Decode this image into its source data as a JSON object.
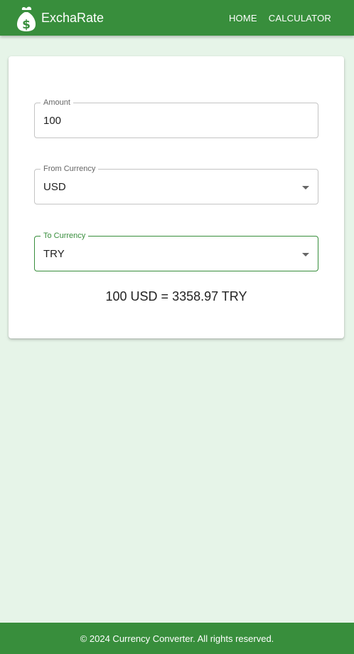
{
  "app": {
    "brand": "ExchaRate",
    "logo_icon": "money-bag-dollar-icon",
    "accent_color": "#388e3c",
    "background_color": "#e6f4e8"
  },
  "nav": {
    "items": [
      {
        "label": "HOME"
      },
      {
        "label": "CALCULATOR"
      }
    ]
  },
  "form": {
    "amount": {
      "label": "Amount",
      "value": "100"
    },
    "from_currency": {
      "label": "From Currency",
      "value": "USD"
    },
    "to_currency": {
      "label": "To Currency",
      "value": "TRY"
    },
    "result": "100 USD = 3358.97 TRY"
  },
  "footer": {
    "text": "© 2024 Currency Converter. All rights reserved."
  }
}
